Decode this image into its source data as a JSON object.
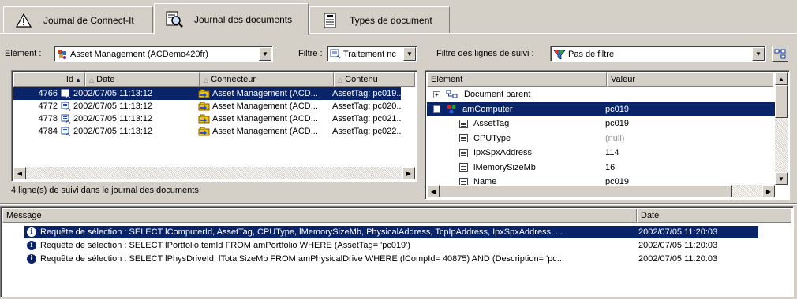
{
  "tabs": [
    {
      "label": "Journal de Connect-It",
      "icon": "warning-icon"
    },
    {
      "label": "Journal des documents",
      "icon": "document-search-icon"
    },
    {
      "label": "Types de document",
      "icon": "document-types-icon"
    }
  ],
  "toolbar": {
    "element_label": "Elément :",
    "element_value": "Asset Management (ACDemo420fr)",
    "filter_label": "Filtre :",
    "filter_value": "Traitement nc",
    "tracking_filter_label": "Filtre des lignes de suivi :",
    "tracking_filter_value": "Pas de filtre"
  },
  "doc_table": {
    "columns": [
      "Id",
      "Date",
      "Connecteur",
      "Contenu"
    ],
    "rows": [
      {
        "id": "4766",
        "date": "2002/07/05 11:13:12",
        "connector": "Asset Management (ACD...",
        "content": "AssetTag: pc019..."
      },
      {
        "id": "4772",
        "date": "2002/07/05 11:13:12",
        "connector": "Asset Management (ACD...",
        "content": "AssetTag: pc020..."
      },
      {
        "id": "4778",
        "date": "2002/07/05 11:13:12",
        "connector": "Asset Management (ACD...",
        "content": "AssetTag: pc021..."
      },
      {
        "id": "4784",
        "date": "2002/07/05 11:13:12",
        "connector": "Asset Management (ACD...",
        "content": "AssetTag: pc022..."
      }
    ],
    "status": "4 ligne(s) de suivi dans le journal des documents"
  },
  "tree": {
    "columns": [
      "Elément",
      "Valeur"
    ],
    "rows": [
      {
        "label": "Document parent",
        "value": ""
      },
      {
        "label": "amComputer",
        "value": "pc019"
      },
      {
        "label": "AssetTag",
        "value": "pc019"
      },
      {
        "label": "CPUType",
        "value": "(null)"
      },
      {
        "label": "IpxSpxAddress",
        "value": "114"
      },
      {
        "label": "lMemorySizeMb",
        "value": "16"
      },
      {
        "label": "Name",
        "value": "pc019"
      }
    ],
    "info_marker": "i"
  },
  "messages": {
    "columns": [
      "Message",
      "Date"
    ],
    "rows": [
      {
        "text": "Requête de sélection : SELECT lComputerId, AssetTag, CPUType, lMemorySizeMb, PhysicalAddress, TcpIpAddress, IpxSpxAddress, ...",
        "date": "2002/07/05 11:20:03"
      },
      {
        "text": "Requête de sélection : SELECT lPortfolioItemId FROM amPortfolio WHERE (AssetTag= 'pc019')",
        "date": "2002/07/05 11:20:03"
      },
      {
        "text": "Requête de sélection : SELECT lPhysDriveId, lTotalSizeMb FROM amPhysicalDrive WHERE (lCompId= 40875) AND (Description= 'pc...",
        "date": "2002/07/05 11:20:03"
      }
    ]
  },
  "colors": {
    "selection": "#0a246a",
    "face": "#d4d0c8"
  }
}
